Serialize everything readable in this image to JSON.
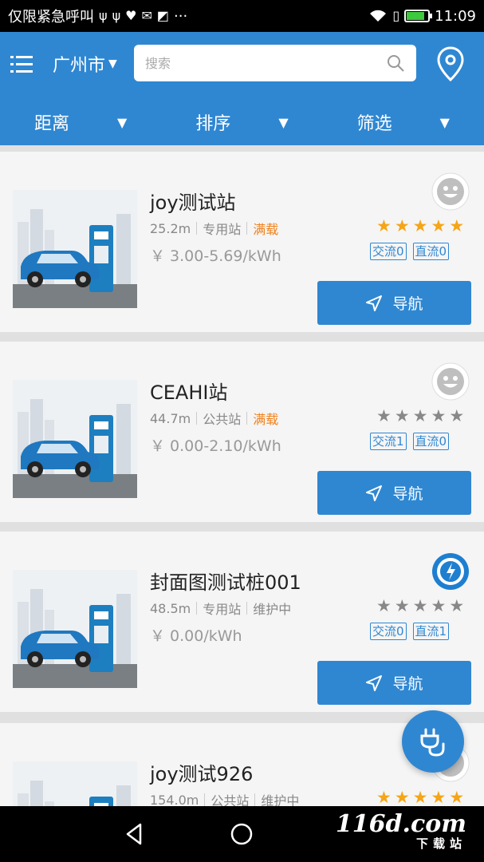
{
  "status_bar": {
    "carrier_text": "仅限紧急呼叫",
    "more_dots": "···",
    "time": "11:09",
    "battery_level": 0.85
  },
  "header": {
    "city": "广州市",
    "search_placeholder": "搜索"
  },
  "filters": [
    {
      "label": "距离"
    },
    {
      "label": "排序"
    },
    {
      "label": "筛选"
    }
  ],
  "stations": [
    {
      "name": "joy测试站",
      "distance": "25.2m",
      "type": "专用站",
      "status": "满载",
      "status_kind": "full",
      "price": "￥ 3.00-5.69/kWh",
      "rating": 5,
      "ac_tag": "交流0",
      "dc_tag": "直流0",
      "operator_logo": "smiley-logo",
      "nav_label": "导航"
    },
    {
      "name": "CEAHI站",
      "distance": "44.7m",
      "type": "公共站",
      "status": "满载",
      "status_kind": "full",
      "price": "￥ 0.00-2.10/kWh",
      "rating": 0,
      "ac_tag": "交流1",
      "dc_tag": "直流0",
      "operator_logo": "smiley-logo",
      "nav_label": "导航"
    },
    {
      "name": "封面图测试桩001",
      "distance": "48.5m",
      "type": "专用站",
      "status": "维护中",
      "status_kind": "maintenance",
      "price": "￥ 0.00/kWh",
      "rating": 0,
      "ac_tag": "交流0",
      "dc_tag": "直流1",
      "operator_logo": "blue-swirl-logo",
      "nav_label": "导航"
    },
    {
      "name": "joy测试926",
      "distance": "154.0m",
      "type": "公共站",
      "status": "维护中",
      "status_kind": "maintenance",
      "price": "",
      "rating": 5,
      "ac_tag": "",
      "dc_tag": "",
      "operator_logo": "smiley-logo",
      "nav_label": ""
    }
  ],
  "watermark": {
    "main": "116d.com",
    "sub": "下载站"
  },
  "colors": {
    "primary": "#2f87d2",
    "full_status": "#f0821e",
    "star_on": "#f5a516",
    "star_off": "#888888"
  }
}
